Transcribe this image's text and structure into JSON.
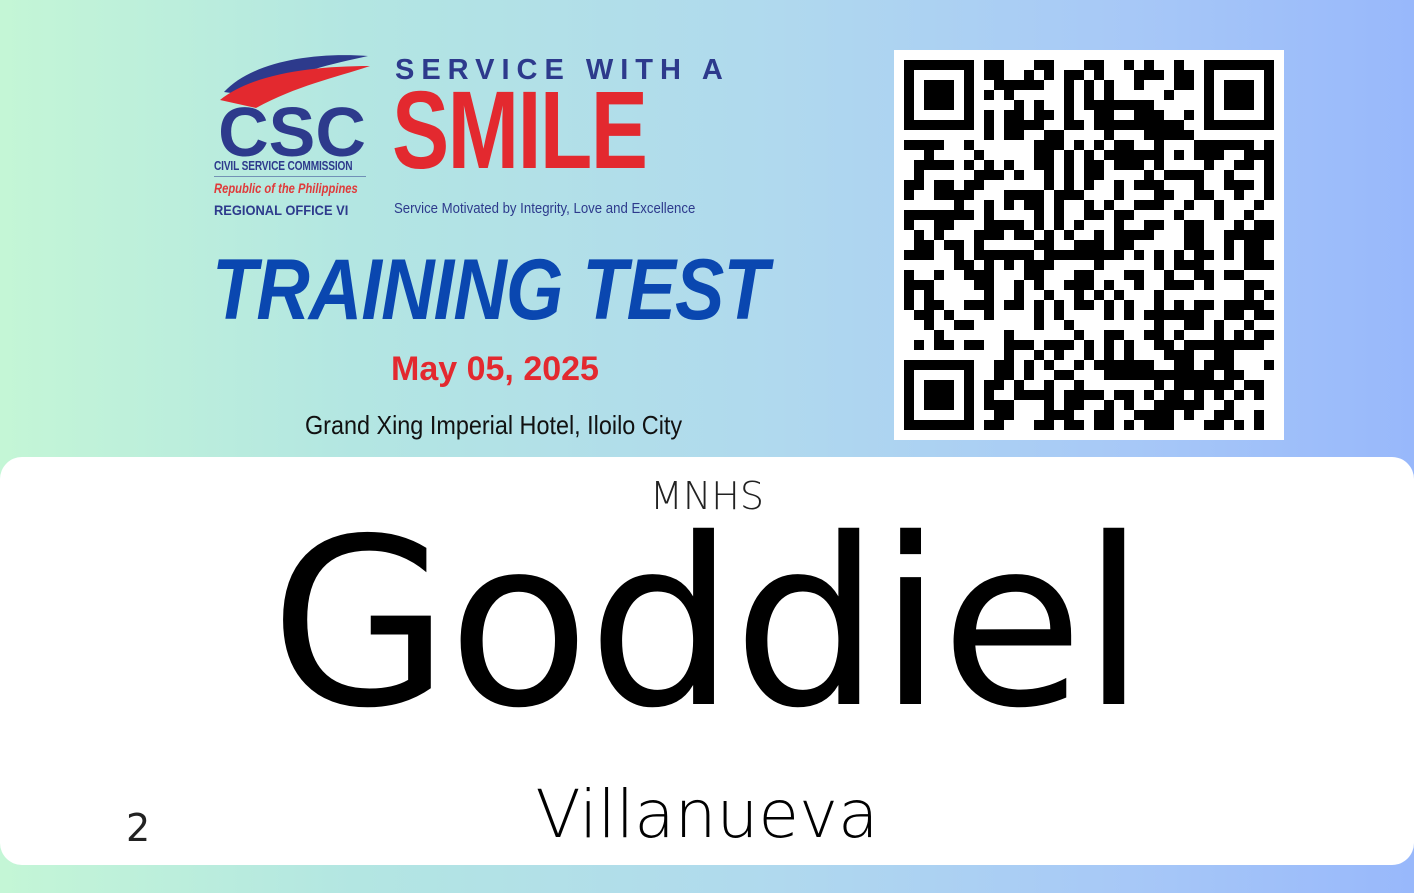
{
  "header": {
    "csc_logo_text": "CSC",
    "csc_name": "CIVIL SERVICE COMMISSION",
    "csc_republic": "Republic of the Philippines",
    "csc_region": "REGIONAL OFFICE VI",
    "slogan_top": "SERVICE WITH A",
    "slogan_main": "SMILE",
    "slogan_sub": "Service Motivated by Integrity, Love and Excellence"
  },
  "event": {
    "title": "TRAINING TEST",
    "date": "May 05, 2025",
    "venue": "Grand Xing Imperial Hotel, Iloilo City"
  },
  "attendee": {
    "organization": "MNHS",
    "first_name": "Goddiel",
    "last_name": "Villanueva",
    "number": "2"
  },
  "colors": {
    "csc_blue": "#2d3a8c",
    "smile_red": "#e3292f",
    "title_blue": "#0a47b0",
    "gradient_start": "#c4f6d6",
    "gradient_end": "#98b8fb"
  },
  "icons": {
    "logo": "csc-emblem-icon",
    "qr": "qr-code-icon"
  }
}
